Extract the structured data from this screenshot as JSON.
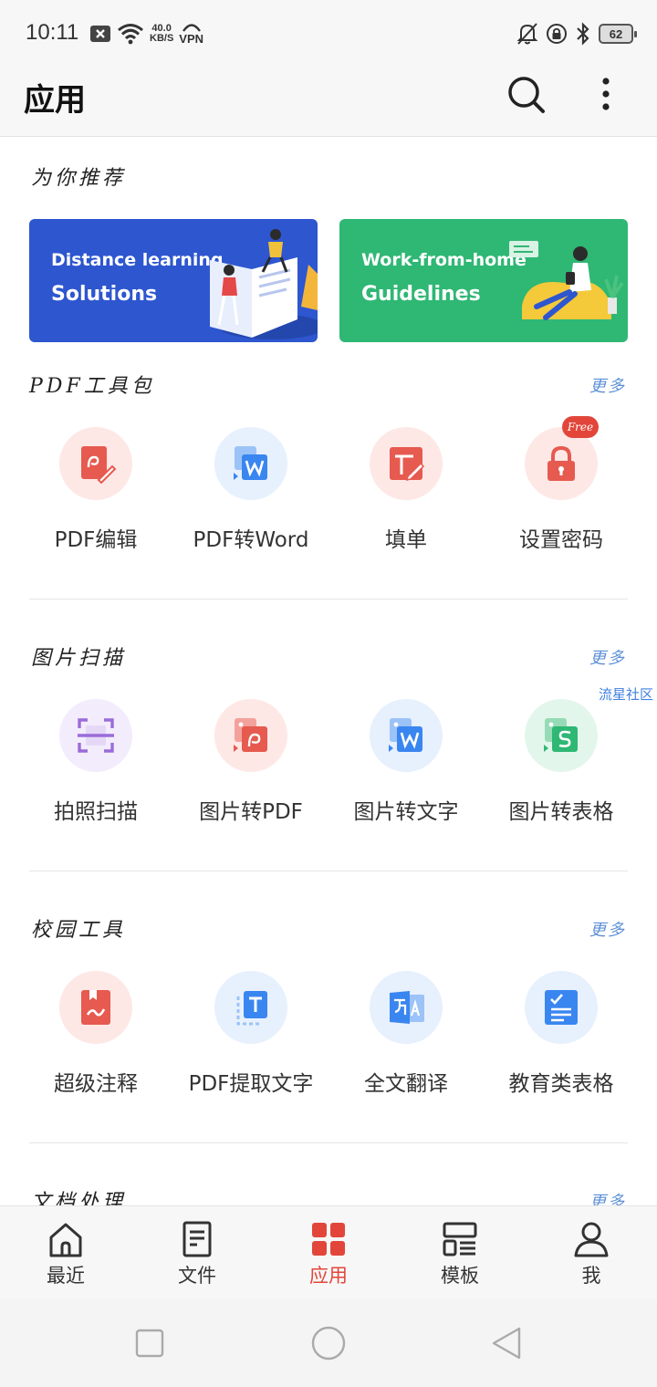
{
  "status_bar": {
    "time": "10:11",
    "speed_value": "40.0",
    "speed_unit": "KB/S",
    "vpn": "VPN",
    "battery": "62"
  },
  "header": {
    "title": "应用"
  },
  "recommend": {
    "title": "为你推荐",
    "banners": [
      {
        "line1": "Distance learning",
        "line2": "Solutions"
      },
      {
        "line1": "Work-from-home",
        "line2": "Guidelines"
      }
    ]
  },
  "sections": [
    {
      "title": "PDF工具包",
      "more": "更多",
      "tools": [
        {
          "label": "PDF编辑",
          "icon": "pdf-edit-icon"
        },
        {
          "label": "PDF转Word",
          "icon": "pdf-to-word-icon"
        },
        {
          "label": "填单",
          "icon": "fill-form-icon"
        },
        {
          "label": "设置密码",
          "icon": "lock-icon",
          "badge": "Free"
        }
      ]
    },
    {
      "title": "图片扫描",
      "more": "更多",
      "tools": [
        {
          "label": "拍照扫描",
          "icon": "scan-icon"
        },
        {
          "label": "图片转PDF",
          "icon": "image-to-pdf-icon"
        },
        {
          "label": "图片转文字",
          "icon": "image-to-text-icon"
        },
        {
          "label": "图片转表格",
          "icon": "image-to-sheet-icon"
        }
      ]
    },
    {
      "title": "校园工具",
      "more": "更多",
      "tools": [
        {
          "label": "超级注释",
          "icon": "annotate-icon"
        },
        {
          "label": "PDF提取文字",
          "icon": "extract-text-icon"
        },
        {
          "label": "全文翻译",
          "icon": "translate-icon"
        },
        {
          "label": "教育类表格",
          "icon": "edu-form-icon"
        }
      ]
    },
    {
      "title": "文档处理",
      "more": "更多"
    }
  ],
  "watermark": "流星社区",
  "bottom_nav": [
    {
      "label": "最近",
      "icon": "home-icon"
    },
    {
      "label": "文件",
      "icon": "file-icon"
    },
    {
      "label": "应用",
      "icon": "apps-icon",
      "active": true
    },
    {
      "label": "模板",
      "icon": "template-icon"
    },
    {
      "label": "我",
      "icon": "person-icon"
    }
  ],
  "colors": {
    "accent": "#e2463a",
    "blue": "#3a86f0",
    "green": "#2fb774",
    "purple": "#9a6cd9"
  }
}
